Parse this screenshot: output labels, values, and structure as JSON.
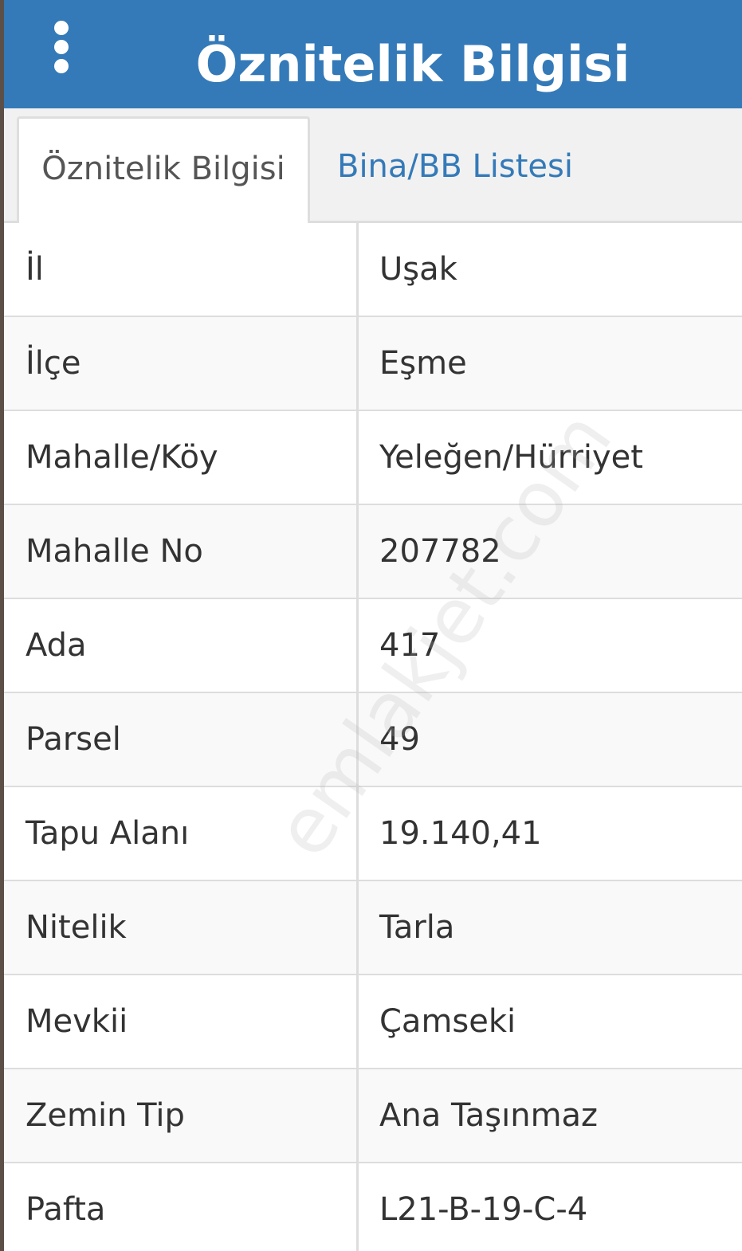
{
  "header": {
    "title": "Öznitelik Bilgisi",
    "menu_icon": "more-vertical-icon",
    "background_color": "#347ab8"
  },
  "tabs": [
    {
      "label": "Öznitelik Bilgisi",
      "active": true
    },
    {
      "label": "Bina/BB Listesi",
      "active": false
    }
  ],
  "table": {
    "rows": [
      {
        "key": "İl",
        "value": "Uşak"
      },
      {
        "key": "İlçe",
        "value": "Eşme"
      },
      {
        "key": "Mahalle/Köy",
        "value": "Yeleğen/Hürriyet"
      },
      {
        "key": "Mahalle No",
        "value": "207782"
      },
      {
        "key": "Ada",
        "value": "417"
      },
      {
        "key": "Parsel",
        "value": "49"
      },
      {
        "key": "Tapu Alanı",
        "value": "19.140,41"
      },
      {
        "key": "Nitelik",
        "value": "Tarla"
      },
      {
        "key": "Mevkii",
        "value": "Çamseki"
      },
      {
        "key": "Zemin Tip",
        "value": "Ana Taşınmaz"
      },
      {
        "key": "Pafta",
        "value": "L21-B-19-C-4"
      }
    ]
  },
  "watermark": "emlakjet.com",
  "colors": {
    "accent": "#347ab8",
    "text": "#333333",
    "border": "#dddddd"
  }
}
